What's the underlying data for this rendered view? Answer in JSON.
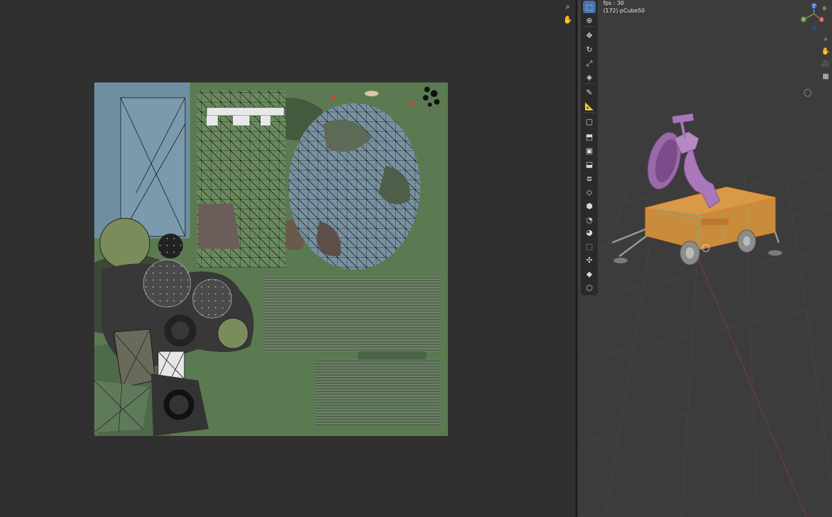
{
  "uv_editor": {
    "tools": [
      {
        "name": "zoom-icon",
        "glyph": "⌕"
      },
      {
        "name": "hand-icon",
        "glyph": "✋"
      }
    ],
    "colors": {
      "background": "#303030",
      "camo_green": "#5c7a52",
      "camo_dark": "#3e4f3a",
      "blue_panel": "#6f8ea2",
      "dark_patch": "#3a3a3a",
      "wire": "#1a1a1a"
    }
  },
  "viewport": {
    "overlay": {
      "fps": "fps : 30",
      "object": "(172) pCube50"
    },
    "toolbar": [
      {
        "name": "select-box-tool-icon",
        "glyph": "⬚",
        "active": true
      },
      {
        "name": "cursor-tool-icon",
        "glyph": "⊕",
        "active": false
      },
      {
        "name": "move-tool-icon",
        "glyph": "✥",
        "active": false
      },
      {
        "name": "rotate-tool-icon",
        "glyph": "↻",
        "active": false
      },
      {
        "name": "scale-tool-icon",
        "glyph": "⤢",
        "active": false
      },
      {
        "name": "transform-tool-icon",
        "glyph": "◈",
        "active": false
      },
      {
        "name": "annotate-tool-icon",
        "glyph": "✎",
        "active": false
      },
      {
        "name": "measure-tool-icon",
        "glyph": "📐",
        "active": false
      },
      {
        "name": "add-cube-tool-icon",
        "glyph": "▢",
        "active": false
      },
      {
        "name": "extrude-tool-icon",
        "glyph": "⬒",
        "active": false
      },
      {
        "name": "inset-tool-icon",
        "glyph": "▣",
        "active": false
      },
      {
        "name": "bevel-tool-icon",
        "glyph": "⬓",
        "active": false
      },
      {
        "name": "loop-cut-tool-icon",
        "glyph": "⧈",
        "active": false
      },
      {
        "name": "knife-tool-icon",
        "glyph": "◇",
        "active": false
      },
      {
        "name": "poly-build-tool-icon",
        "glyph": "⬢",
        "active": false
      },
      {
        "name": "spin-tool-icon",
        "glyph": "◔",
        "active": false
      },
      {
        "name": "smooth-tool-icon",
        "glyph": "◕",
        "active": false
      },
      {
        "name": "edge-slide-tool-icon",
        "glyph": "⬚",
        "active": false
      },
      {
        "name": "shrink-fatten-tool-icon",
        "glyph": "✣",
        "active": false
      },
      {
        "name": "shear-tool-icon",
        "glyph": "◆",
        "active": false
      },
      {
        "name": "rip-tool-icon",
        "glyph": "⬡",
        "active": false
      }
    ],
    "nav": [
      {
        "name": "zoom-view-icon",
        "glyph": "⌕"
      },
      {
        "name": "pan-view-icon",
        "glyph": "✋"
      },
      {
        "name": "camera-view-icon",
        "glyph": "🎥"
      },
      {
        "name": "perspective-toggle-icon",
        "glyph": "▦"
      }
    ],
    "gizmo_axes": {
      "x": "X",
      "y": "Y",
      "z": "Z"
    },
    "colors": {
      "background": "#3c3c3c",
      "grid": "#474747",
      "x_axis": "#8a3a3a",
      "selected_orange": "#f0821e",
      "dish_purple": "#a878b8",
      "body_orange": "#c98b3c",
      "wheels_gray": "#8c8c8c"
    }
  }
}
